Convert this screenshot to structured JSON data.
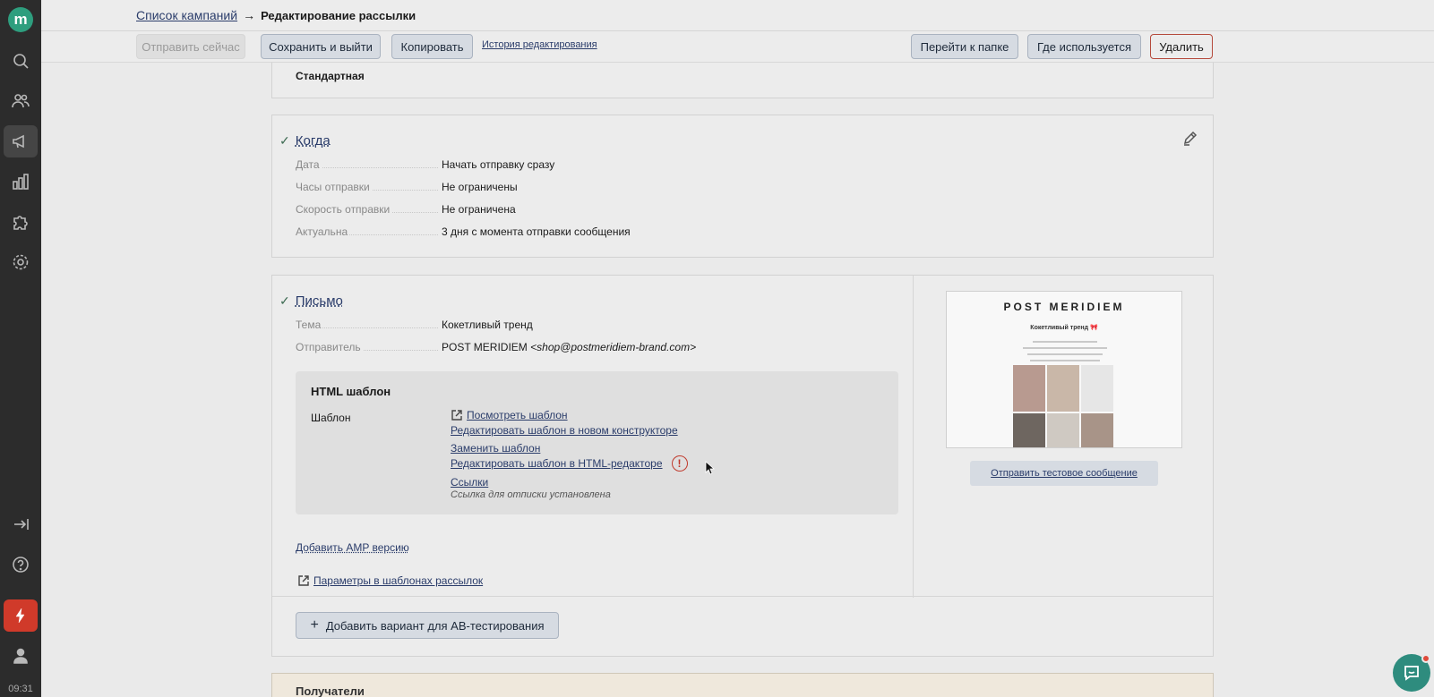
{
  "sidebar": {
    "logo": "m",
    "time": "09:31",
    "icons": [
      "search-icon",
      "users-icon",
      "megaphone-icon",
      "chart-icon",
      "puzzle-icon",
      "gear-icon",
      "logout-icon",
      "help-icon",
      "bolt-icon",
      "user-icon"
    ]
  },
  "breadcrumb": {
    "parent": "Список кампаний",
    "arrow": "→",
    "current": "Редактирование рассылки"
  },
  "toolbar": {
    "send_now": "Отправить сейчас",
    "save_exit": "Сохранить и выйти",
    "copy": "Копировать",
    "history": "История редактирования",
    "go_folder": "Перейти к папке",
    "where_used": "Где используется",
    "delete": "Удалить"
  },
  "top_card": {
    "value": "Стандартная"
  },
  "when": {
    "check": "✓",
    "title": "Когда",
    "rows": [
      {
        "key": "Дата",
        "value": "Начать отправку сразу"
      },
      {
        "key": "Часы отправки",
        "value": "Не ограничены"
      },
      {
        "key": "Скорость отправки",
        "value": "Не ограничена"
      },
      {
        "key": "Актуальна",
        "value": "3 дня с момента отправки сообщения"
      }
    ]
  },
  "letter": {
    "check": "✓",
    "title": "Письмо",
    "subject_key": "Тема",
    "subject_value": "Кокетливый тренд",
    "sender_key": "Отправитель",
    "sender_name": "POST MERIDIEM",
    "sender_email": "<shop@postmeridiem-brand.com>",
    "html_title": "HTML шаблон",
    "template_label": "Шаблон",
    "links": {
      "view": "Посмотреть шаблон",
      "edit_new": "Редактировать шаблон в новом конструкторе",
      "replace": "Заменить шаблон",
      "edit_html": "Редактировать шаблон в HTML-редакторе",
      "warn": "!",
      "links": "Ссылки",
      "unsub_note": "Ссылка для отписки установлена"
    },
    "add_amp": "Добавить AMP версию",
    "params": "Параметры в шаблонах рассылок",
    "preview": {
      "brand": "POST MERIDIEM",
      "subject": "Кокетливый тренд 🎀",
      "photo_colors": [
        "#b89a90",
        "#c9b7a8",
        "#e6e6e6",
        "#6e6660",
        "#cfc9c2",
        "#a89488"
      ]
    },
    "send_test": "Отправить тестовое сообщение",
    "ab_plus": "+",
    "ab_test": "Добавить вариант для AB-тестирования"
  },
  "bottom_card": {
    "title": "Получатели"
  }
}
